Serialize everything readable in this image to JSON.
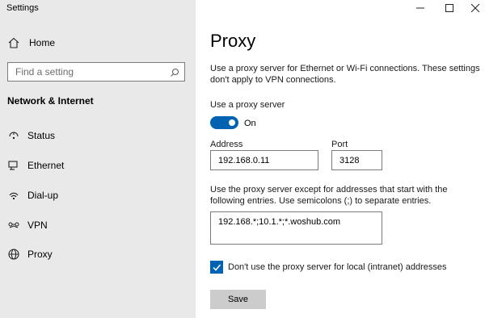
{
  "window": {
    "title": "Settings"
  },
  "sidebar": {
    "home_label": "Home",
    "search_placeholder": "Find a setting",
    "section_title": "Network & Internet",
    "items": [
      {
        "label": "Status",
        "icon": "status-icon"
      },
      {
        "label": "Ethernet",
        "icon": "ethernet-icon"
      },
      {
        "label": "Dial-up",
        "icon": "dialup-icon"
      },
      {
        "label": "VPN",
        "icon": "vpn-icon"
      },
      {
        "label": "Proxy",
        "icon": "globe-icon"
      }
    ]
  },
  "main": {
    "title": "Proxy",
    "description": "Use a proxy server for Ethernet or Wi-Fi connections. These settings don't apply to VPN connections.",
    "use_proxy_label": "Use a proxy server",
    "toggle_state": "On",
    "address_label": "Address",
    "address_value": "192.168.0.11",
    "port_label": "Port",
    "port_value": "3128",
    "exceptions_label": "Use the proxy server except for addresses that start with the following entries. Use semicolons (;) to separate entries.",
    "exceptions_value": "192.168.*;10.1.*;*.woshub.com",
    "local_checkbox_label": "Don't use the proxy server for local (intranet) addresses",
    "local_checkbox_checked": true,
    "save_label": "Save"
  },
  "colors": {
    "accent": "#0063b1",
    "sidebar_bg": "#e9e9e9",
    "button_bg": "#cccccc"
  }
}
